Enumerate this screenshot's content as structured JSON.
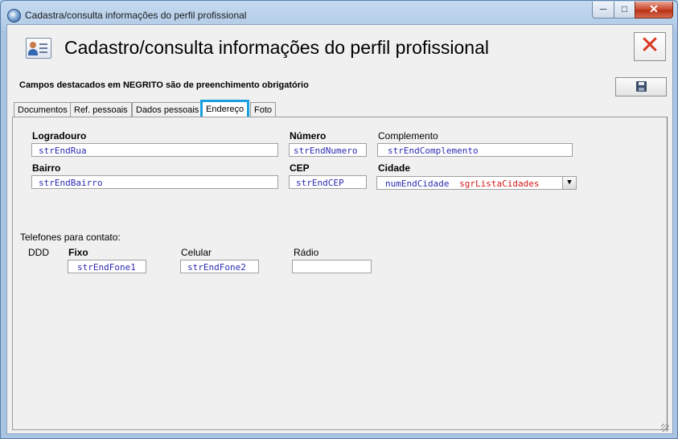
{
  "window": {
    "title": "Cadastra/consulta informações do perfil profissional",
    "min_glyph": "─",
    "max_glyph": "□",
    "close_glyph": "✕"
  },
  "header": {
    "title": "Cadastro/consulta informações do perfil profissional",
    "close_glyph": "✕",
    "icon": "profile-card-icon"
  },
  "note": "Campos destacados em NEGRITO são de preenchimento obrigatório",
  "tabs": [
    {
      "label": "Documentos"
    },
    {
      "label": "Ref. pessoais"
    },
    {
      "label": "Dados pessoais"
    },
    {
      "label": "Endereço",
      "selected": true
    },
    {
      "label": "Foto"
    }
  ],
  "address": {
    "logradouro": {
      "label": "Logradouro",
      "value": "strEndRua"
    },
    "numero": {
      "label": "Número",
      "value": "strEndNumero"
    },
    "complemento": {
      "label": "Complemento",
      "value": "strEndComplemento"
    },
    "bairro": {
      "label": "Bairro",
      "value": "strEndBairro"
    },
    "cep": {
      "label": "CEP",
      "value": "strEndCEP"
    },
    "cidade": {
      "label": "Cidade",
      "value_id": "numEndCidade",
      "value_list": "sgrListaCidades",
      "arrow": "▼"
    }
  },
  "phones": {
    "section_label": "Telefones para contato:",
    "ddd_label": "DDD",
    "fixo": {
      "label": "Fixo",
      "value": "strEndFone1"
    },
    "celular": {
      "label": "Celular",
      "value": "strEndFone2"
    },
    "radio": {
      "label": "Rádio",
      "value": ""
    }
  },
  "colors": {
    "selected_tab_border": "#1aa0e0",
    "field_text": "#2b2bb0",
    "combo_list_text": "#d01818",
    "close_accent": "#d9361f"
  }
}
